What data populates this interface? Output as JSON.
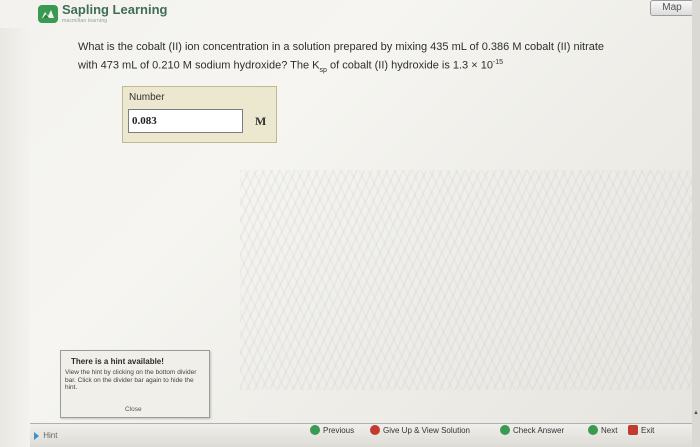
{
  "header": {
    "brand": "Sapling Learning",
    "brand_sub": "macmillan learning",
    "map_label": "Map"
  },
  "question": {
    "line1": "What is the cobalt (II) ion concentration in a solution prepared by mixing 435 mL of 0.386 M cobalt (II) nitrate",
    "line2_pre": "with 473 mL of 0.210 M sodium hydroxide? The K",
    "ksp_sub": "sp",
    "line2_mid": " of cobalt (II) hydroxide is 1.3 × 10",
    "exp": "-15"
  },
  "answer": {
    "label": "Number",
    "value": "0.083",
    "unit": "M"
  },
  "hint_popup": {
    "title": "There is a hint available!",
    "text": "View the hint by clicking on the bottom divider bar. Click on the divider bar again to hide the hint.",
    "close": "Close"
  },
  "bottom_bar": {
    "hint": "Hint",
    "previous": "Previous",
    "give_up": "Give Up & View Solution",
    "check": "Check Answer",
    "next": "Next",
    "exit": "Exit"
  },
  "colors": {
    "brand_green": "#3a9a52",
    "answer_bg": "#ece7cf",
    "previous_icon": "#3a9a52",
    "give_up_icon": "#c23b2f",
    "check_icon": "#3a9a52",
    "next_icon": "#3a9a52",
    "exit_icon": "#c23b2f"
  }
}
